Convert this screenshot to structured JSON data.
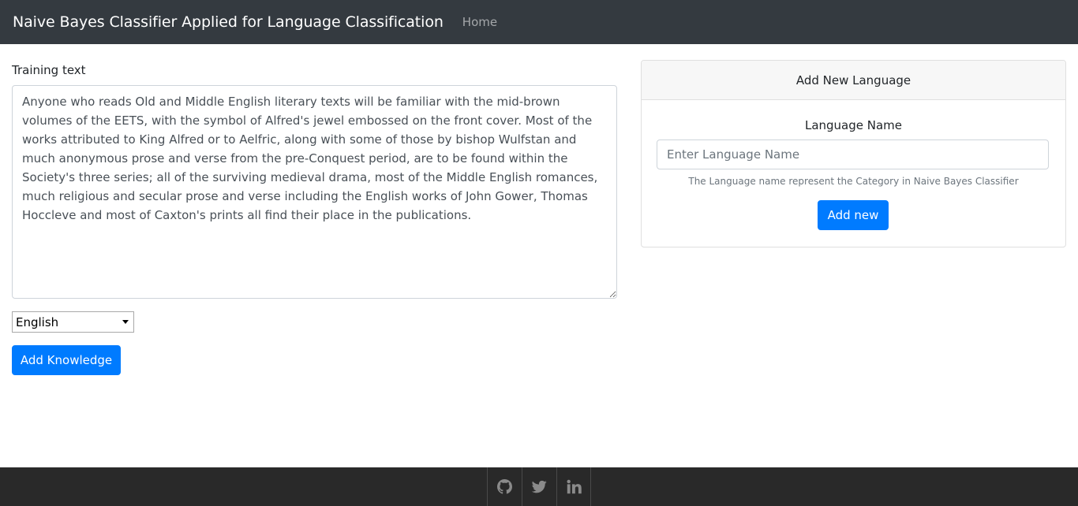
{
  "navbar": {
    "brand": "Naive Bayes Classifier Applied for Language Classification",
    "home_link": "Home"
  },
  "training": {
    "label": "Training text",
    "text": "Anyone who reads Old and Middle English literary texts will be familiar with the mid-brown volumes of the EETS, with the symbol of Alfred's jewel embossed on the front cover. Most of the works attributed to King Alfred or to Aelfric, along with some of those by bishop Wulfstan and much anonymous prose and verse from the pre-Conquest period, are to be found within the Society's three series; all of the surviving medieval drama, most of the Middle English romances, much religious and secular prose and verse including the English works of John Gower, Thomas Hoccleve and most of Caxton's prints all find their place in the publications.",
    "language_select": "English",
    "add_knowledge_button": "Add Knowledge"
  },
  "add_language_card": {
    "header": "Add New Language",
    "name_label": "Language Name",
    "name_placeholder": "Enter Language Name",
    "name_value": "",
    "help_text": "The Language name represent the Category in Naive Bayes Classifier",
    "add_button": "Add new"
  },
  "footer": {
    "icons": [
      "github-icon",
      "twitter-icon",
      "linkedin-icon"
    ]
  },
  "colors": {
    "navbar_bg": "#343a40",
    "primary": "#007bff",
    "footer_bg": "#292929"
  }
}
